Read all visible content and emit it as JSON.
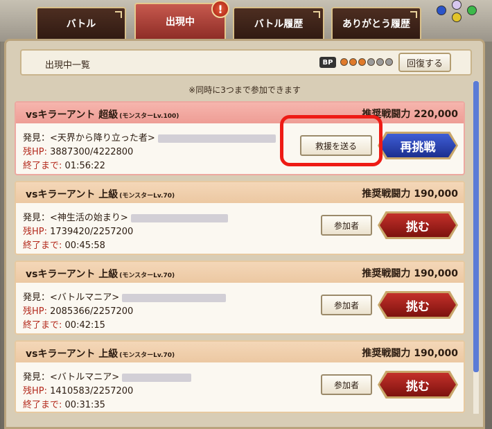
{
  "tabs": [
    {
      "label": "バトル",
      "active": false
    },
    {
      "label": "出現中",
      "active": true
    },
    {
      "label": "バトル履歴",
      "active": false
    },
    {
      "label": "ありがとう履歴",
      "active": false
    }
  ],
  "alert_badge": "!",
  "header": {
    "title": "出現中一覧",
    "bp_label": "BP",
    "bp_total": 6,
    "bp_filled": 3,
    "recover_label": "回復する"
  },
  "notice": "※同時に3つまで参加できます",
  "labels": {
    "discovery": "発見：",
    "hp": "残HP:",
    "until_end": "終了まで:"
  },
  "cards": [
    {
      "title": "vsキラーアント 超級",
      "level": "(モンスターLv.100)",
      "power": "推奨戦闘力 220,000",
      "discoverer": "<天界から降り立った者>",
      "hp": "3887300/4222800",
      "time": "01:56:22",
      "small_button": "救援を送る",
      "big_button": "再挑戦",
      "style": "pink"
    },
    {
      "title": "vsキラーアント 上級",
      "level": "(モンスターLv.70)",
      "power": "推奨戦闘力 190,000",
      "discoverer": "<神生活の始まり>",
      "hp": "1739420/2257200",
      "time": "00:45:58",
      "small_button": "参加者",
      "big_button": "挑む",
      "style": "orange"
    },
    {
      "title": "vsキラーアント 上級",
      "level": "(モンスターLv.70)",
      "power": "推奨戦闘力 190,000",
      "discoverer": "<バトルマニア>",
      "hp": "2085366/2257200",
      "time": "00:42:15",
      "small_button": "参加者",
      "big_button": "挑む",
      "style": "orange"
    },
    {
      "title": "vsキラーアント 上級",
      "level": "(モンスターLv.70)",
      "power": "推奨戦闘力 190,000",
      "discoverer": "<バトルマニア>",
      "hp": "1410583/2257200",
      "time": "00:31:35",
      "small_button": "参加者",
      "big_button": "挑む",
      "style": "orange"
    }
  ],
  "colors": {
    "accent_red": "#ee1b15",
    "retry_blue": "#2a43b0",
    "challenge_red": "#a01c16",
    "bp_filled": "#e07a2a",
    "bp_empty": "#9b9b9b"
  }
}
